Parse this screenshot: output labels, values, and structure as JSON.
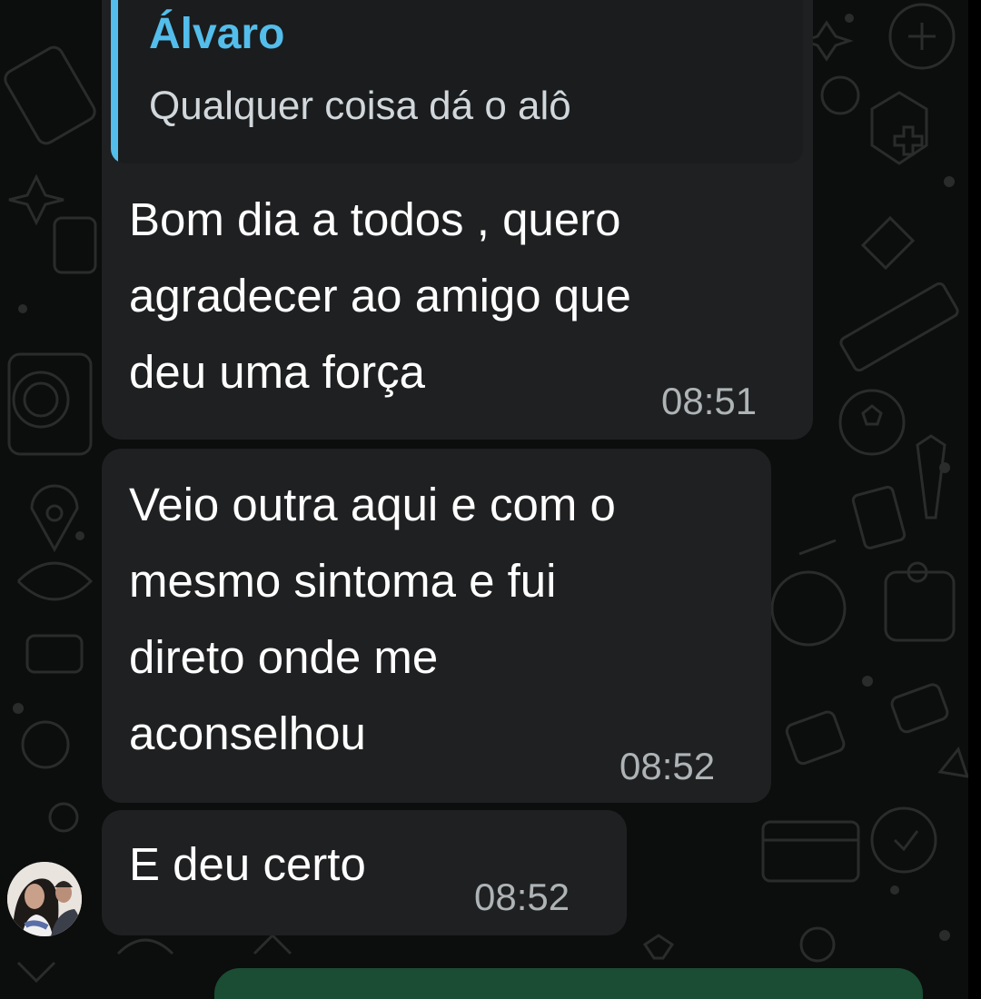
{
  "messages": [
    {
      "quote": {
        "author": "Álvaro",
        "text": "Qualquer coisa dá o alô"
      },
      "lines": [
        "Bom dia a todos , quero",
        "agradecer ao amigo que",
        "deu uma força"
      ],
      "time": "08:51"
    },
    {
      "lines": [
        "Veio outra aqui e com o",
        "mesmo sintoma e fui",
        "direto onde me",
        "aconselhou"
      ],
      "time": "08:52"
    },
    {
      "lines": [
        "E deu certo"
      ],
      "time": "08:52"
    }
  ],
  "colors": {
    "bubble": "#1f2021",
    "quote_accent": "#53bdeb",
    "compose_bar": "#1a4d33"
  }
}
